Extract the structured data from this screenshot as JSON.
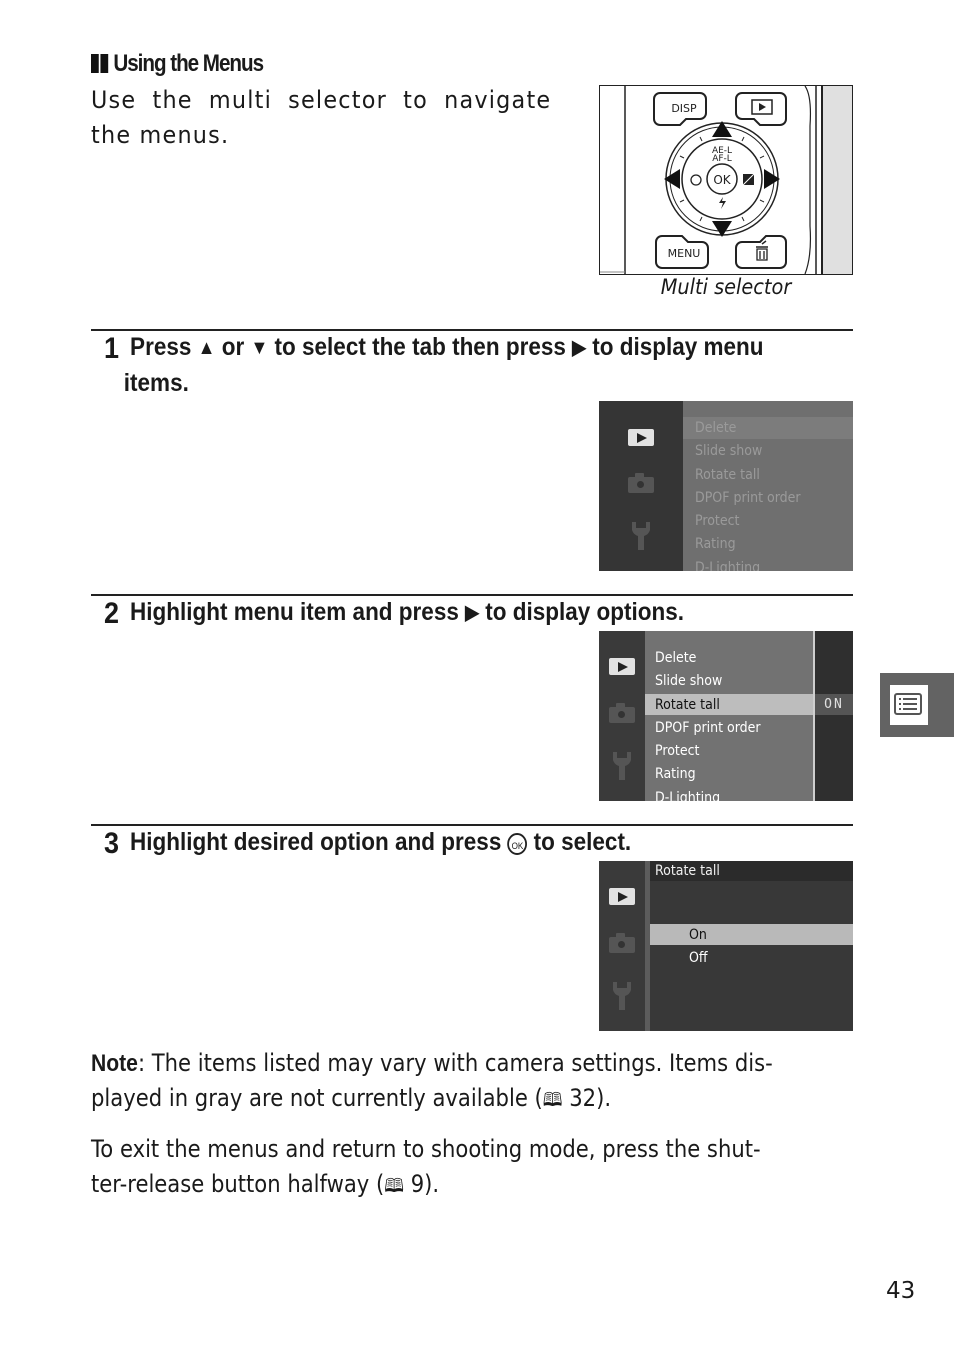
{
  "section": {
    "heading": "Using the Menus",
    "intro": "Use the multi selector to navigate the menus."
  },
  "multi_selector": {
    "caption": "Multi selector",
    "buttons": {
      "disp": "DISP",
      "menu": "MENU",
      "ok": "OK",
      "ae_l": "AE-L",
      "af_l": "AF-L"
    }
  },
  "steps": [
    {
      "number": "1",
      "line1_parts": [
        "Press",
        "▲",
        "or",
        "▼",
        "to select the tab then press",
        "▶",
        "to display menu"
      ],
      "line2": "items.",
      "screen": {
        "menu_items": [
          "Delete",
          "Slide show",
          "Rotate tall",
          "DPOF print order",
          "Protect",
          "Rating",
          "D-Lighting"
        ],
        "highlighted": "Delete"
      }
    },
    {
      "number": "2",
      "text_before": "Highlight menu item and press",
      "arrow": "▶",
      "text_after": "to display options.",
      "screen": {
        "menu_items": [
          "Delete",
          "Slide show",
          "Rotate tall",
          "DPOF print order",
          "Protect",
          "Rating",
          "D-Lighting"
        ],
        "highlighted": "Rotate tall",
        "current_value": "ON"
      }
    },
    {
      "number": "3",
      "text_before": "Highlight desired option and press",
      "ok_glyph": "OK",
      "text_after": "to select.",
      "screen": {
        "title": "Rotate tall",
        "options": [
          "On",
          "Off"
        ],
        "highlighted": "On"
      }
    }
  ],
  "note": {
    "label": "Note",
    "text_line1": ": The items listed may vary with camera settings.  Items dis-",
    "text_line2_before": "played in gray are not currently available (",
    "ref_page": "32",
    "text_line2_after": ")."
  },
  "exit_para": {
    "line1": "To exit the menus and return to shooting mode, press the shut-",
    "line2_before": "ter-release button halfway (",
    "ref_page": "9",
    "line2_after": ")."
  },
  "book_icon": "🕮",
  "tab_marker_icon": "menu-list-icon",
  "page_number": "43"
}
